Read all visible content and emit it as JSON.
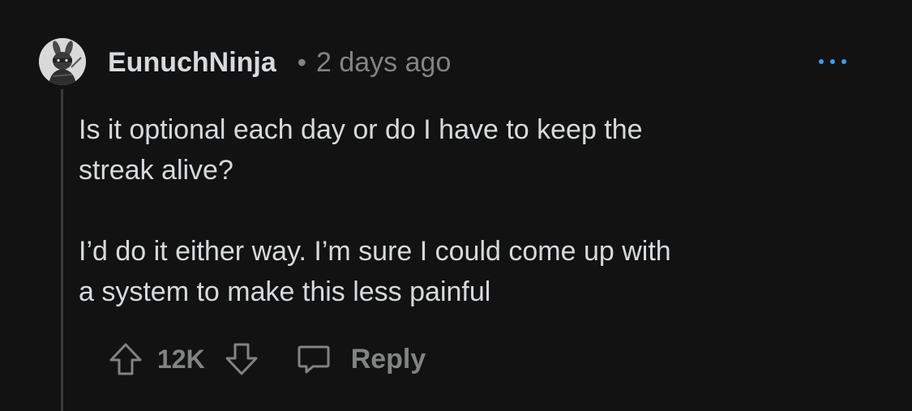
{
  "comment": {
    "author": "EunuchNinja",
    "separator": "•",
    "timestamp": "2 days ago",
    "paragraphs": [
      "Is it optional each day or do I have to keep the\nstreak alive?",
      "I’d do it either way. I’m sure I could come up with\na system to make this less painful"
    ],
    "score": "12K",
    "reply_label": "Reply"
  },
  "icons": {
    "avatar": "ninja-bunny-avatar",
    "more": "more-options-icon",
    "upvote": "arrow-up-icon",
    "downvote": "arrow-down-icon",
    "reply": "speech-bubble-icon"
  },
  "colors": {
    "background": "#121212",
    "primary_text": "#d7dadc",
    "secondary_text": "#818384",
    "accent": "#3b9cf0",
    "thread_line": "#3a3a3a"
  }
}
